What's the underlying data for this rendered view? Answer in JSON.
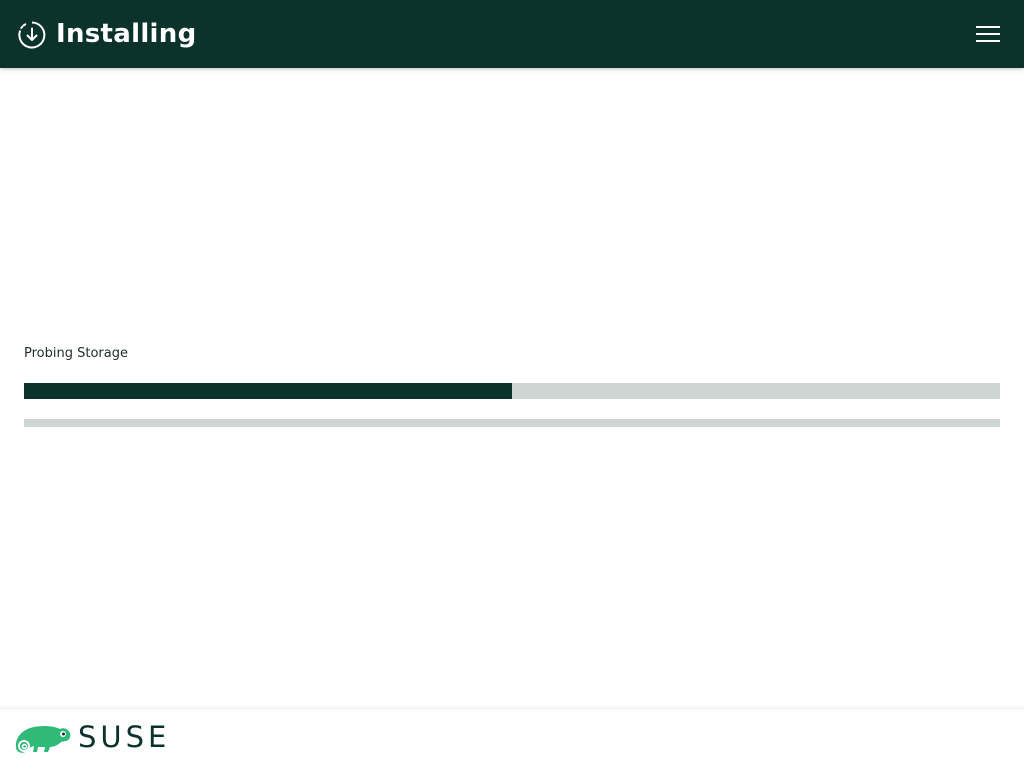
{
  "header": {
    "title": "Installing",
    "icon": "download-circle-icon",
    "menu_icon": "hamburger-menu-icon",
    "background_color": "#0c322c"
  },
  "progress": {
    "step_label": "Probing Storage",
    "primary_fraction": 0.5,
    "secondary_fraction": 0.0,
    "fill_color": "#0c322c",
    "track_color": "#cfd5d3"
  },
  "footer": {
    "logo_icon": "suse-chameleon-icon",
    "logo_text": "SUSE",
    "logo_color": "#30ba78"
  }
}
